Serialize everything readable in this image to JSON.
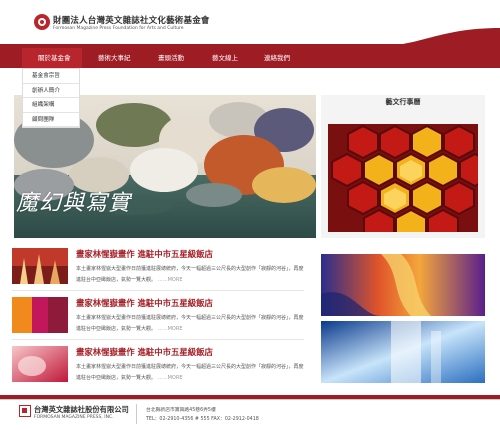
{
  "header": {
    "org_name_zh": "財團法人台灣英文雜誌社文化藝術基金會",
    "org_name_en": "Formosan Magazine Press Foundation for Arts and Culture"
  },
  "nav": {
    "items": [
      {
        "label": "關於基金會"
      },
      {
        "label": "藝術大事紀"
      },
      {
        "label": "畫頭活動"
      },
      {
        "label": "藝文線上"
      },
      {
        "label": "連絡我們"
      }
    ]
  },
  "dropdown": {
    "items": [
      {
        "label": "基金會宗旨"
      },
      {
        "label": "創辦人簡介"
      },
      {
        "label": "組織架構"
      },
      {
        "label": "顧問團隊"
      }
    ]
  },
  "hero": {
    "title": "魔幻與寫實"
  },
  "side_panel": {
    "title": "藝文行事曆"
  },
  "news": [
    {
      "title": "畫家林惺嶽畫作 進駐中市五星級飯店",
      "body": "本土畫家林惺嶽大型畫作日前獲進駐展總統府，今天一幅超過三公尺長的大型創作「寂靜的河谷」，再度進駐台中亞緻飯店，氣勢一覽大觀。",
      "more": "……MORE"
    },
    {
      "title": "畫家林惺嶽畫作 進駐中市五星級飯店",
      "body": "本土畫家林惺嶽大型畫作日前獲進駐展總統府，今天一幅超過三公尺長的大型創作「寂靜的河谷」，再度進駐台中亞緻飯店，氣勢一覽大觀。",
      "more": "……MORE"
    },
    {
      "title": "畫家林惺嶽畫作 進駐中市五星級飯店",
      "body": "本土畫家林惺嶽大型畫作日前獲進駐展總統府，今天一幅超過三公尺長的大型創作「寂靜的河谷」，再度進駐台中亞緻飯店，氣勢一覽大觀。",
      "more": "……MORE"
    }
  ],
  "footer": {
    "company_zh": "台灣英文雜誌社股份有限公司",
    "company_en": "FORMOSAN MAGAZINE PRESS, INC.",
    "address": "台北縣新店市寶興路45巷6弄5樓",
    "contact": "TEL：02-2910-4356 # 555    FAX：02-2912-0418"
  },
  "colors": {
    "brand_red": "#9e1c23",
    "title_red": "#a41f26"
  }
}
